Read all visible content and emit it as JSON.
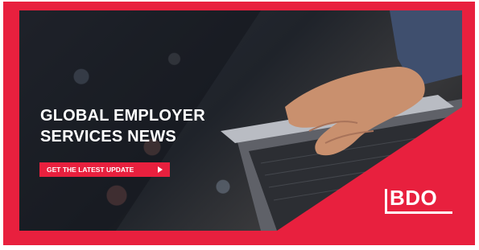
{
  "banner": {
    "headline_line1": "GLOBAL EMPLOYER",
    "headline_line2": "SERVICES NEWS",
    "cta_label": "GET THE LATEST UPDATE",
    "brand_logo_text": "BDO"
  },
  "colors": {
    "brand_red": "#e8203e",
    "text": "#ffffff",
    "photo_dark": "#1f232a"
  },
  "icons": {
    "cta_arrow": "triangle-right"
  }
}
